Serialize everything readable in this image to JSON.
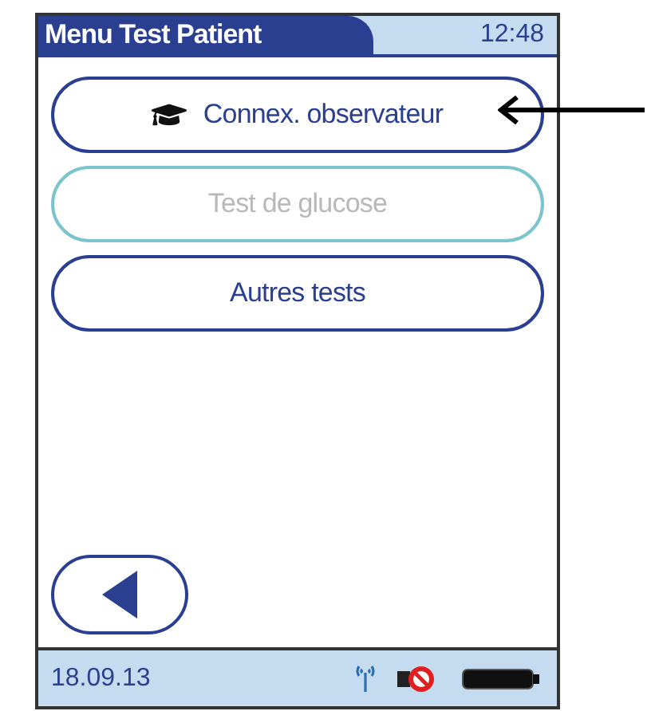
{
  "header": {
    "title": "Menu Test Patient",
    "time": "12:48"
  },
  "menu_buttons": [
    {
      "label": "Connex. observateur",
      "disabled": false,
      "kind": "with_icon"
    },
    {
      "label": "Test de glucose",
      "disabled": true,
      "kind": "plain"
    },
    {
      "label": "Autres tests",
      "disabled": false,
      "kind": "plain"
    }
  ],
  "status_bar": {
    "date": "18.09.13"
  }
}
